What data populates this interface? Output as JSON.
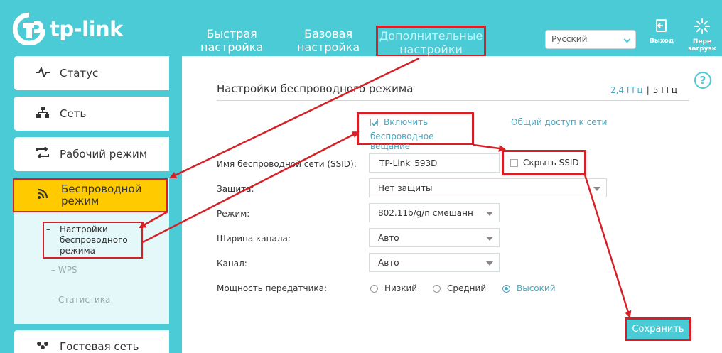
{
  "header": {
    "logo_text": "tp-link",
    "nav_tabs": [
      {
        "line1": "Быстрая",
        "line2": "настройка"
      },
      {
        "line1": "Базовая",
        "line2": "настройка"
      },
      {
        "line1": "Дополнительные",
        "line2": "настройки"
      }
    ],
    "language": "Русский",
    "logout_label": "Выход",
    "reboot_line1": "Пере",
    "reboot_line2": "загрузк"
  },
  "sidebar": {
    "items": [
      {
        "label": "Статус",
        "icon": "pulse-icon"
      },
      {
        "label": "Сеть",
        "icon": "network-icon"
      },
      {
        "label": "Рабочий режим",
        "icon": "mode-switch-icon"
      }
    ],
    "active": {
      "line1": "Беспроводной",
      "line2": "режим",
      "icon": "wifi-icon"
    },
    "sub_items": {
      "settings_line1": "Настройки",
      "settings_line2": "беспроводного",
      "settings_line3": "режима",
      "wps": "WPS",
      "stats": "Статистика"
    },
    "guest": {
      "label": "Гостевая сеть",
      "icon": "guest-users-icon"
    }
  },
  "main": {
    "title": "Настройки беспроводного режима",
    "freq_24": "2,4 ГГц",
    "freq_sep": "|",
    "freq_5": "5 ГГц",
    "enable_line1": "Включить",
    "enable_line2": "беспроводное вещание",
    "share_link": "Общий доступ к сети",
    "ssid_label": "Имя беспроводной сети (SSID):",
    "ssid_value": "TP-Link_593D",
    "hide_ssid": "Скрыть SSID",
    "security_label": "Защита:",
    "security_value": "Нет защиты",
    "mode_label": "Режим:",
    "mode_value": "802.11b/g/n смешанн",
    "width_label": "Ширина канала:",
    "width_value": "Авто",
    "channel_label": "Канал:",
    "channel_value": "Авто",
    "power_label": "Мощность передатчика:",
    "power_options": [
      "Низкий",
      "Средний",
      "Высокий"
    ],
    "power_selected": "Высокий",
    "save": "Сохранить"
  },
  "colors": {
    "accent": "#4acbd6",
    "highlight": "#ffcb00",
    "annotation": "#d62027"
  }
}
